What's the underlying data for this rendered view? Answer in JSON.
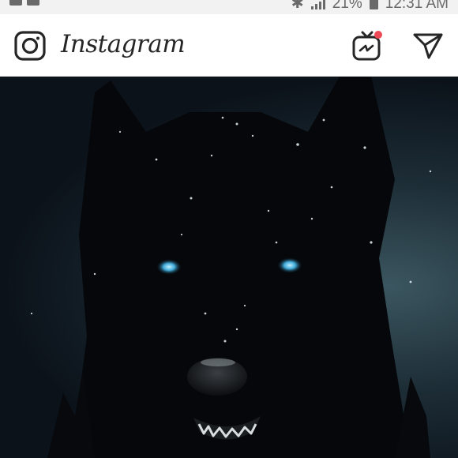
{
  "status_bar": {
    "battery": "21%",
    "time": "12:31 AM"
  },
  "header": {
    "app_name": "Instagram",
    "icons": [
      "camera-icon",
      "igtv-icon",
      "direct-message-icon"
    ],
    "notification_dot_color": "#ed4956"
  },
  "post": {
    "subject": "black wolf with blue eyes in snow",
    "eye_color": "#3fa9d8"
  }
}
